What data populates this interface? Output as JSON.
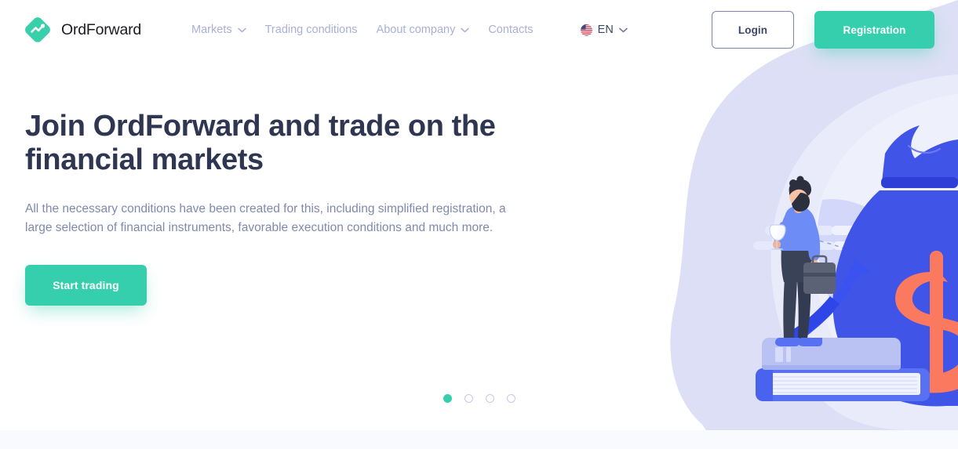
{
  "brand": {
    "name": "OrdForward",
    "logo_icon": "diamond-chart-logo-icon",
    "accent": "#36cfae"
  },
  "header": {
    "nav": [
      {
        "label": "Markets",
        "has_dropdown": true,
        "icon": "chevron-down-icon"
      },
      {
        "label": "Trading conditions",
        "has_dropdown": false
      },
      {
        "label": "About company",
        "has_dropdown": true,
        "icon": "chevron-down-icon"
      },
      {
        "label": "Contacts",
        "has_dropdown": false
      }
    ],
    "language": {
      "code": "EN",
      "flag_icon": "us-flag-icon",
      "chevron_icon": "chevron-down-icon"
    },
    "login_label": "Login",
    "registration_label": "Registration",
    "nav_color": "#a9b0d6",
    "login_border_color": "#7d87ad"
  },
  "hero": {
    "title": "Join OrdForward and trade on the financial markets",
    "subtitle": "All the necessary conditions have been created for this, including simplified registration, a large selection of financial instruments, favorable execution conditions and much more.",
    "cta_label": "Start trading",
    "title_color": "#2e3652",
    "subtitle_color": "#8089ac",
    "illustration": "businessman-on-books-with-money-bag-illustration"
  },
  "carousel": {
    "slides": 4,
    "active_index": 0,
    "active_color": "#36cfae",
    "idle_color": "#c5c9e8"
  },
  "palette": {
    "blob_outer": "#dcdff5",
    "blob_inner": "#e9ebfa",
    "money_bag_blue": "#4154e8",
    "dollar_coral": "#fb7a5f",
    "shirt_blue": "#6e8cf5",
    "pants_navy": "#3a4257",
    "below_fold_bg": "#f8fafd"
  }
}
